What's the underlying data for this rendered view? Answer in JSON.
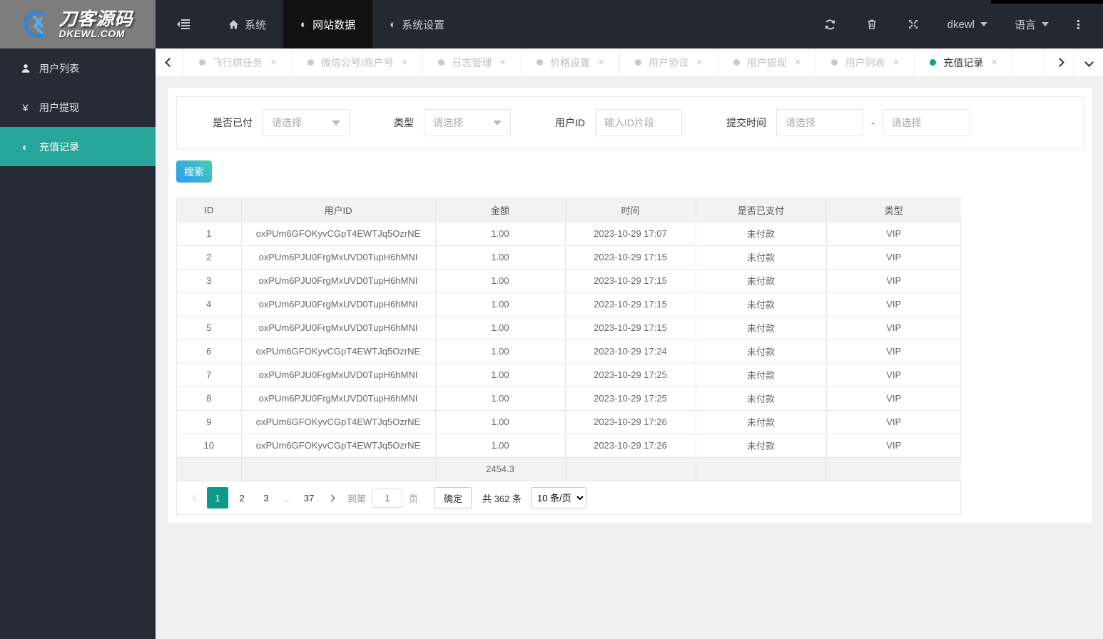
{
  "topbar": {
    "logo": {
      "title": "刀客源码",
      "subtitle": "DKEWL.COM"
    },
    "nav": [
      {
        "label": "系统",
        "state": ""
      },
      {
        "label": "网站数据",
        "state": "active"
      },
      {
        "label": "系统设置",
        "state": ""
      }
    ],
    "user_label": "dkewl",
    "language_label": "语言"
  },
  "tabbar": {
    "tabs": [
      {
        "label": "飞行棋任务",
        "state": ""
      },
      {
        "label": "微信公号/商户号",
        "state": ""
      },
      {
        "label": "日志管理",
        "state": ""
      },
      {
        "label": "价格设置",
        "state": ""
      },
      {
        "label": "用户协议",
        "state": ""
      },
      {
        "label": "用户提现",
        "state": ""
      },
      {
        "label": "用户列表",
        "state": ""
      },
      {
        "label": "充值记录",
        "state": "active"
      }
    ]
  },
  "sidebar": {
    "items": [
      {
        "label": "用户列表",
        "state": ""
      },
      {
        "label": "用户提现",
        "state": ""
      },
      {
        "label": "充值记录",
        "state": "active"
      }
    ]
  },
  "filters": {
    "paid": {
      "label": "是否已付",
      "placeholder": "请选择"
    },
    "type": {
      "label": "类型",
      "placeholder": "请选择"
    },
    "user_id": {
      "label": "用户ID",
      "placeholder": "输入ID片段"
    },
    "submit_time": {
      "label": "提交时间",
      "from_placeholder": "请选择",
      "separator": "-",
      "to_placeholder": "请选择"
    }
  },
  "search_button": "搜索",
  "table": {
    "columns": [
      "ID",
      "用户ID",
      "金额",
      "时间",
      "是否已支付",
      "类型"
    ],
    "rows": [
      [
        "1",
        "oxPUm6GFOKyvCGpT4EWTJq5OzrNE",
        "1.00",
        "2023-10-29 17:07",
        "未付款",
        "VIP"
      ],
      [
        "2",
        "oxPUm6PJU0FrgMxUVD0TupH6hMNI",
        "1.00",
        "2023-10-29 17:15",
        "未付款",
        "VIP"
      ],
      [
        "3",
        "oxPUm6PJU0FrgMxUVD0TupH6hMNI",
        "1.00",
        "2023-10-29 17:15",
        "未付款",
        "VIP"
      ],
      [
        "4",
        "oxPUm6PJU0FrgMxUVD0TupH6hMNI",
        "1.00",
        "2023-10-29 17:15",
        "未付款",
        "VIP"
      ],
      [
        "5",
        "oxPUm6PJU0FrgMxUVD0TupH6hMNI",
        "1.00",
        "2023-10-29 17:15",
        "未付款",
        "VIP"
      ],
      [
        "6",
        "oxPUm6GFOKyvCGpT4EWTJq5OzrNE",
        "1.00",
        "2023-10-29 17:24",
        "未付款",
        "VIP"
      ],
      [
        "7",
        "oxPUm6PJU0FrgMxUVD0TupH6hMNI",
        "1.00",
        "2023-10-29 17:25",
        "未付款",
        "VIP"
      ],
      [
        "8",
        "oxPUm6PJU0FrgMxUVD0TupH6hMNI",
        "1.00",
        "2023-10-29 17:25",
        "未付款",
        "VIP"
      ],
      [
        "9",
        "oxPUm6GFOKyvCGpT4EWTJq5OzrNE",
        "1.00",
        "2023-10-29 17:26",
        "未付款",
        "VIP"
      ],
      [
        "10",
        "oxPUm6GFOKyvCGpT4EWTJq5OzrNE",
        "1.00",
        "2023-10-29 17:26",
        "未付款",
        "VIP"
      ]
    ],
    "summary_amount": "2454.3"
  },
  "pagination": {
    "pages": [
      {
        "label": "1",
        "state": "active"
      },
      {
        "label": "2",
        "state": ""
      },
      {
        "label": "3",
        "state": ""
      },
      {
        "label": "...",
        "state": "ellipsis"
      },
      {
        "label": "37",
        "state": ""
      }
    ],
    "goto_prefix": "到第",
    "goto_value": "1",
    "goto_suffix": "页",
    "confirm": "确定",
    "total": "共 362 条",
    "page_size": "10 条/页"
  },
  "icons": {
    "contrast_icon": "◐",
    "yen_icon": "¥",
    "close_icon": "×"
  },
  "colors": {
    "navbar_bg": "#232831",
    "sidebar_bg": "#262C35",
    "nav_active_bg": "#121212",
    "logo_bg": "#7D7D7D",
    "accent_teal": "#26A69A",
    "page_active_teal": "#0D9A88",
    "tab_active_dot": "#0FA08D",
    "button_gradient_start": "#47CDB4",
    "button_gradient_end": "#2E9BF2",
    "table_border": "#E7E7E7",
    "table_header_bg": "#F2F2F2",
    "content_bg": "#F1F1F2"
  }
}
